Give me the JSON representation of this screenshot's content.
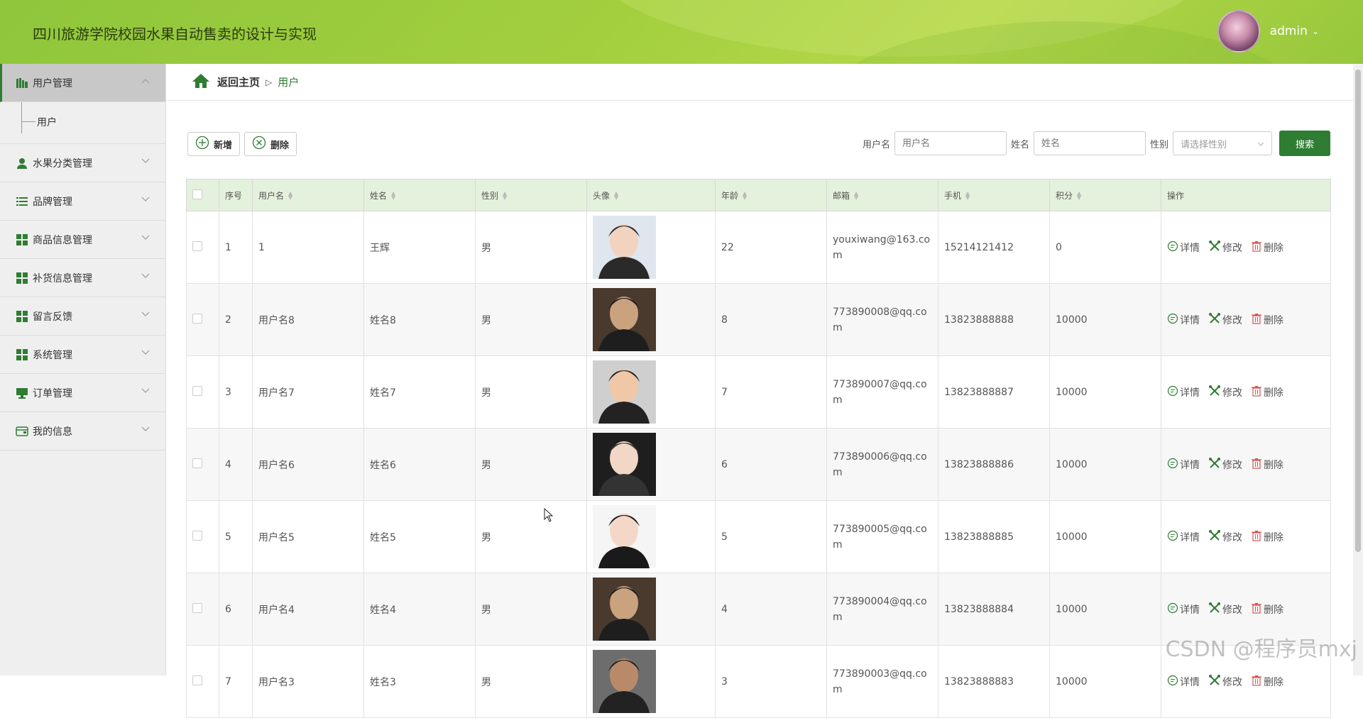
{
  "header": {
    "title": "四川旅游学院校园水果自动售卖的设计与实现",
    "user": "admin"
  },
  "sidebar": {
    "items": [
      {
        "label": "用户管理",
        "icon": "library-icon",
        "active": true,
        "expanded": true
      },
      {
        "label": "水果分类管理",
        "icon": "user-icon"
      },
      {
        "label": "品牌管理",
        "icon": "list-icon"
      },
      {
        "label": "商品信息管理",
        "icon": "grid-icon"
      },
      {
        "label": "补货信息管理",
        "icon": "grid-icon"
      },
      {
        "label": "留言反馈",
        "icon": "grid-icon"
      },
      {
        "label": "系统管理",
        "icon": "grid-icon"
      },
      {
        "label": "订单管理",
        "icon": "monitor-icon"
      },
      {
        "label": "我的信息",
        "icon": "wallet-icon"
      }
    ],
    "submenu": {
      "label": "用户"
    }
  },
  "breadcrumb": {
    "home": "返回主页",
    "current": "用户"
  },
  "toolbar": {
    "add": "新增",
    "delete": "删除"
  },
  "search": {
    "username_label": "用户名",
    "username_placeholder": "用户名",
    "name_label": "姓名",
    "name_placeholder": "姓名",
    "gender_label": "性别",
    "gender_placeholder": "请选择性别",
    "button": "搜索"
  },
  "table": {
    "columns": [
      "序号",
      "用户名",
      "姓名",
      "性别",
      "头像",
      "年龄",
      "邮箱",
      "手机",
      "积分",
      "操作"
    ],
    "actions": {
      "detail": "详情",
      "edit": "修改",
      "delete": "删除"
    },
    "rows": [
      {
        "index": "1",
        "username": "1",
        "name": "王辉",
        "gender": "男",
        "age": "22",
        "email": "youxiwang@163.com",
        "phone": "15214121412",
        "points": "0"
      },
      {
        "index": "2",
        "username": "用户名8",
        "name": "姓名8",
        "gender": "男",
        "age": "8",
        "email": "773890008@qq.com",
        "phone": "13823888888",
        "points": "10000"
      },
      {
        "index": "3",
        "username": "用户名7",
        "name": "姓名7",
        "gender": "男",
        "age": "7",
        "email": "773890007@qq.com",
        "phone": "13823888887",
        "points": "10000"
      },
      {
        "index": "4",
        "username": "用户名6",
        "name": "姓名6",
        "gender": "男",
        "age": "6",
        "email": "773890006@qq.com",
        "phone": "13823888886",
        "points": "10000"
      },
      {
        "index": "5",
        "username": "用户名5",
        "name": "姓名5",
        "gender": "男",
        "age": "5",
        "email": "773890005@qq.com",
        "phone": "13823888885",
        "points": "10000"
      },
      {
        "index": "6",
        "username": "用户名4",
        "name": "姓名4",
        "gender": "男",
        "age": "4",
        "email": "773890004@qq.com",
        "phone": "13823888884",
        "points": "10000"
      },
      {
        "index": "7",
        "username": "用户名3",
        "name": "姓名3",
        "gender": "男",
        "age": "3",
        "email": "773890003@qq.com",
        "phone": "13823888883",
        "points": "10000"
      }
    ]
  },
  "watermark": "CSDN @程序员mxj",
  "colors": {
    "accent": "#2e7d32",
    "header": "#9bcb3c",
    "table_header": "#e4f1dc"
  }
}
